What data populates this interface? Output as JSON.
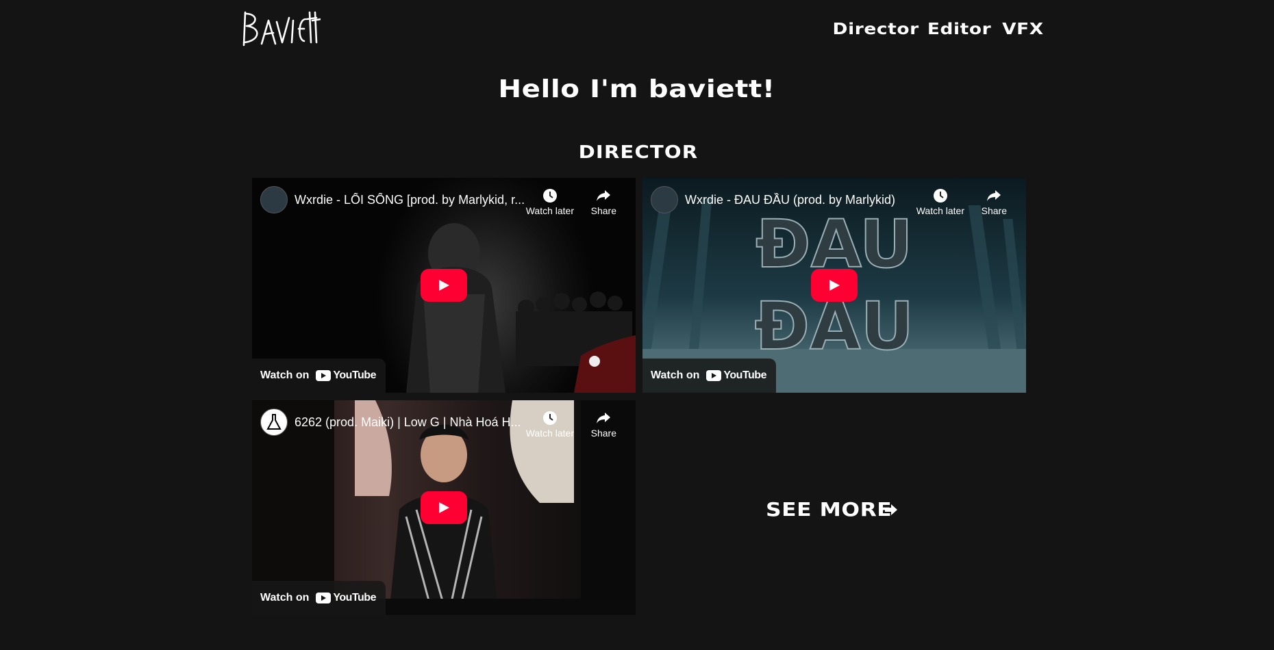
{
  "brand": {
    "logo_text": "BAVIETT"
  },
  "nav": {
    "items": [
      "Director",
      "Editor",
      "VFX"
    ]
  },
  "hero": {
    "title": "Hello I'm baviett!"
  },
  "section": {
    "title": "DIRECTOR"
  },
  "videos": [
    {
      "title": "Wxrdie - LỐI SỐNG [prod. by Marlykid, r...",
      "watch_later": "Watch later",
      "share": "Share",
      "watch_on": "Watch on",
      "youtube": "YouTube"
    },
    {
      "title": "Wxrdie - ĐAU ĐẦU (prod. by Marlykid)",
      "watch_later": "Watch later",
      "share": "Share",
      "watch_on": "Watch on",
      "youtube": "YouTube",
      "overlay_text": "ĐAU ĐẦU"
    },
    {
      "title": "6262 (prod. Maiki) | Low G | Nhà Hoá H...",
      "watch_later": "Watch later",
      "share": "Share",
      "watch_on": "Watch on",
      "youtube": "YouTube"
    }
  ],
  "see_more": {
    "label": "SEE MORE"
  },
  "colors": {
    "background": "#141414",
    "youtube_red": "#ff0033",
    "text": "#ffffff"
  }
}
